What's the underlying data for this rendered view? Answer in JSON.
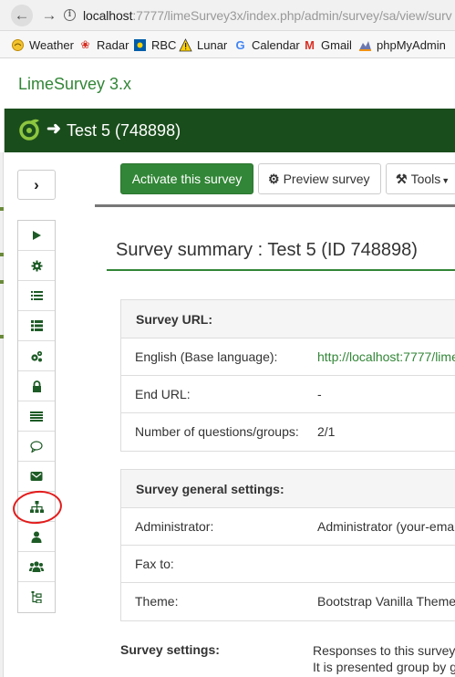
{
  "browser": {
    "url_host": "localhost",
    "url_rest": ":7777/limeSurvey3x/index.php/admin/survey/sa/view/surv",
    "bookmarks": [
      {
        "label": "Weather",
        "icon": "weather-icon"
      },
      {
        "label": "Radar",
        "icon": "maple-leaf-icon"
      },
      {
        "label": "RBC",
        "icon": "rbc-icon"
      },
      {
        "label": "Lunar",
        "icon": "warning-icon"
      },
      {
        "label": "Calendar",
        "icon": "google-icon"
      },
      {
        "label": "Gmail",
        "icon": "gmail-icon"
      },
      {
        "label": "phpMyAdmin",
        "icon": "phpmyadmin-icon"
      }
    ]
  },
  "app": {
    "brand": "LimeSurvey 3.x",
    "survey_title": "Test 5 (748898)"
  },
  "toolbar": {
    "activate": "Activate this survey",
    "preview": "Preview survey",
    "tools": "Tools"
  },
  "sidemenu": {
    "items": [
      {
        "icon": "play-icon"
      },
      {
        "icon": "gear-icon"
      },
      {
        "icon": "list-icon"
      },
      {
        "icon": "list-alt-icon"
      },
      {
        "icon": "cogs-icon"
      },
      {
        "icon": "lock-icon"
      },
      {
        "icon": "bars-icon"
      },
      {
        "icon": "comment-icon"
      },
      {
        "icon": "envelope-icon"
      },
      {
        "icon": "sitemap-icon"
      },
      {
        "icon": "user-icon"
      },
      {
        "icon": "users-icon"
      },
      {
        "icon": "tree-icon"
      }
    ]
  },
  "main": {
    "summary_title": "Survey summary : Test 5 (ID 748898)",
    "url_panel": {
      "heading": "Survey URL:",
      "rows": [
        {
          "key": "English (Base language):",
          "value": "http://localhost:7777/lime"
        },
        {
          "key": "End URL:",
          "value": "-"
        },
        {
          "key": "Number of questions/groups:",
          "value": "2/1"
        }
      ]
    },
    "general_panel": {
      "heading": "Survey general settings:",
      "rows": [
        {
          "key": "Administrator:",
          "value": "Administrator (your-ema"
        },
        {
          "key": "Fax to:",
          "value": ""
        },
        {
          "key": "Theme:",
          "value": "Bootstrap Vanilla Theme"
        }
      ]
    },
    "settings_label": "Survey settings:",
    "settings_line1": "Responses to this survey",
    "settings_line2": "It is presented group by g"
  },
  "colors": {
    "brand_green": "#328637",
    "title_bar": "#1a4d1c",
    "annotation_red": "#e31b1b"
  }
}
